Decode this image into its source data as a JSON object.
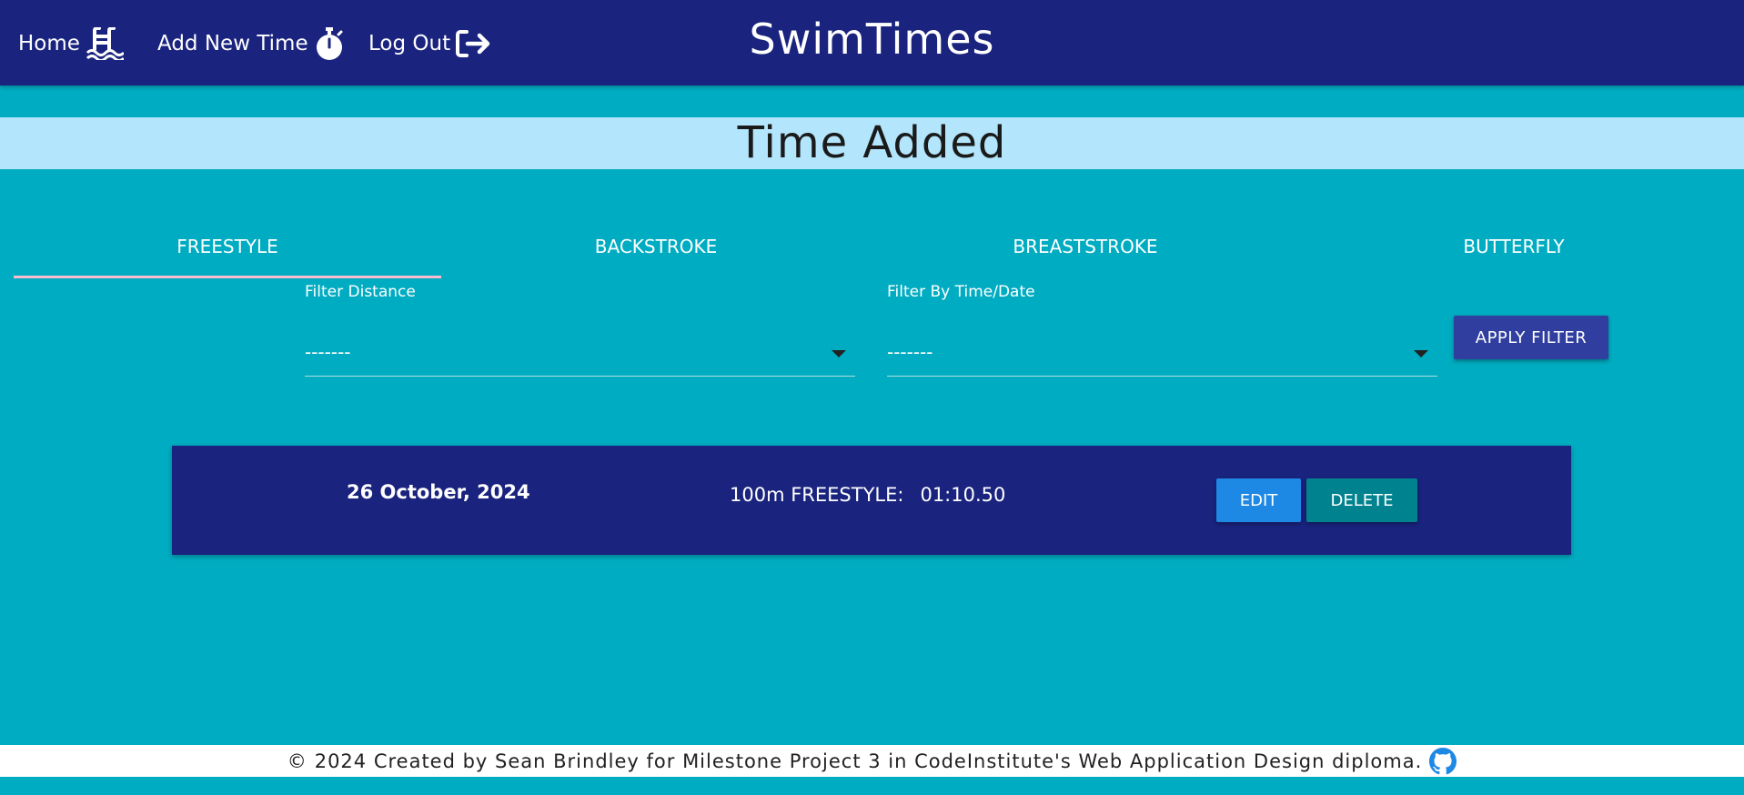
{
  "nav": {
    "home_label": "Home",
    "home_icon": "swimming-pool-icon",
    "add_label": "Add New Time",
    "add_icon": "stopwatch-icon",
    "logout_label": "Log Out",
    "logout_icon": "sign-out-icon",
    "brand": "SwimTimes"
  },
  "banner": {
    "title": "Time Added"
  },
  "tabs": [
    {
      "label": "FREESTYLE",
      "active": true
    },
    {
      "label": "BACKSTROKE",
      "active": false
    },
    {
      "label": "BREASTSTROKE",
      "active": false
    },
    {
      "label": "BUTTERFLY",
      "active": false
    }
  ],
  "filters": {
    "distance_label": "Filter Distance",
    "distance_value": "-------",
    "time_label": "Filter By Time/Date",
    "time_value": "-------",
    "apply_label": "APPLY FILTER"
  },
  "entries": [
    {
      "date": "26 October, 2024",
      "event": "100m FREESTYLE:",
      "time": "01:10.50",
      "edit_label": "EDIT",
      "delete_label": "DELETE"
    }
  ],
  "footer": {
    "copyright_symbol": "©",
    "text": "2024 Created by Sean Brindley for Milestone Project 3 in CodeInstitute's Web Application Design diploma.",
    "github_icon": "github-icon"
  },
  "colors": {
    "nav_bg": "#1a237e",
    "page_bg": "#00acc1",
    "banner_bg": "#b3e5fc",
    "apply_btn": "#303f9f",
    "edit_btn": "#1e88e5",
    "delete_btn": "#00838f",
    "tab_indicator": "#f8bbd0"
  }
}
